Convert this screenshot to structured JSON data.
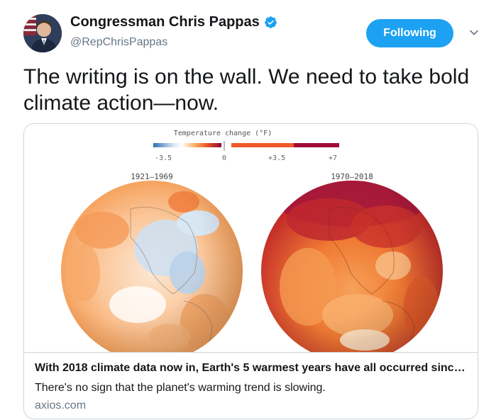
{
  "author": {
    "name": "Congressman Chris Pappas",
    "handle": "@RepChrisPappas",
    "verified": true
  },
  "follow_label": "Following",
  "tweet": {
    "text": "The writing is on the wall. We need to take bold climate action—now."
  },
  "card": {
    "legend_title": "Temperature change (°F)",
    "legend_ticks": [
      "-3.5",
      "0",
      "+3.5",
      "+7"
    ],
    "left_globe_label": "1921–1969",
    "right_globe_label": "1970–2018",
    "title": "With 2018 climate data now in, Earth's 5 warmest years have all occurred sinc…",
    "description": "There's no sign that the planet's warming trend is slowing.",
    "domain": "axios.com"
  },
  "colors": {
    "accent": "#1da1f2",
    "secondary_text": "#657786",
    "border": "#ccd6dd"
  },
  "icons": [
    "verified-badge-icon",
    "chevron-down-icon"
  ]
}
